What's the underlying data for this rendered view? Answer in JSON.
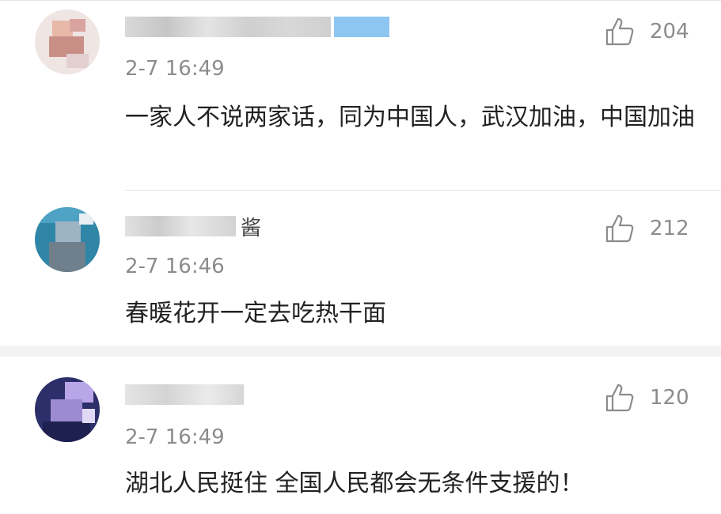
{
  "comments": [
    {
      "username_suffix": "",
      "time": "2-7 16:49",
      "likes": "204",
      "text": "一家人不说两家话，同为中国人，武汉加油，中国加油"
    },
    {
      "username_suffix": "酱",
      "time": "2-7 16:46",
      "likes": "212",
      "text": "春暖花开一定去吃热干面"
    },
    {
      "username_suffix": "",
      "time": "2-7 16:49",
      "likes": "120",
      "text": "湖北人民挺住 全国人民都会无条件支援的！"
    }
  ],
  "icons": {
    "like": "thumbs-up-icon"
  },
  "colors": {
    "meta": "#8c8c8c",
    "text": "#222222",
    "background": "#f2f2f2"
  }
}
